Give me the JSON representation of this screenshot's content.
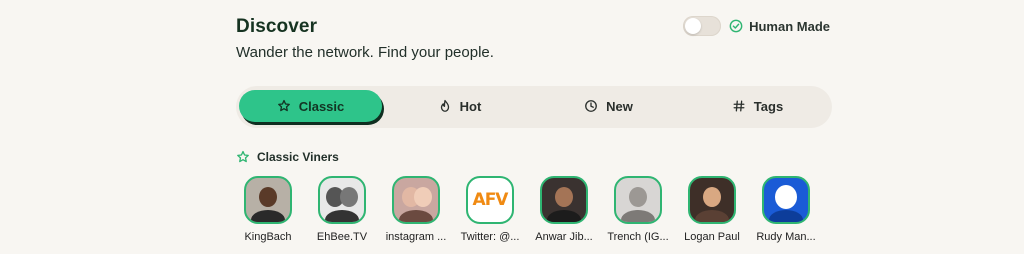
{
  "header": {
    "title": "Discover",
    "subtitle": "Wander the network. Find your people.",
    "human_made_label": "Human Made",
    "human_made_enabled": false
  },
  "tabs": [
    {
      "label": "Classic",
      "icon": "star-icon",
      "active": true
    },
    {
      "label": "Hot",
      "icon": "flame-icon",
      "active": false
    },
    {
      "label": "New",
      "icon": "clock-icon",
      "active": false
    },
    {
      "label": "Tags",
      "icon": "hash-icon",
      "active": false
    }
  ],
  "section": {
    "title": "Classic Viners",
    "icon": "star-outline-icon"
  },
  "viners": [
    {
      "name": "KingBach"
    },
    {
      "name": "EhBee.TV"
    },
    {
      "name": "instagram ..."
    },
    {
      "name": "Twitter: @..."
    },
    {
      "name": "Anwar Jib..."
    },
    {
      "name": "Trench (IG..."
    },
    {
      "name": "Logan Paul"
    },
    {
      "name": "Rudy Man..."
    }
  ],
  "colors": {
    "accent": "#2ec48a",
    "avatar_border": "#2fb572",
    "background": "#f8f6f2"
  }
}
